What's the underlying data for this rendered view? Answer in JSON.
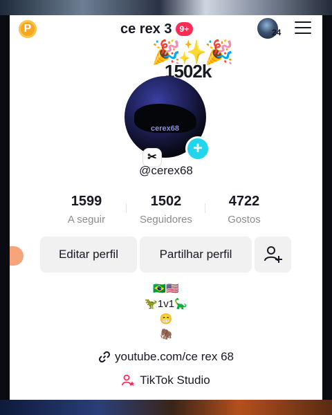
{
  "header": {
    "coin_label": "P",
    "title": "ce rex 3",
    "notification_badge": "9+",
    "avatar_count": "24"
  },
  "profile": {
    "party_emoji": "🎉✨🎉",
    "follower_banner": "1502k",
    "pfp_watermark": "cerex68",
    "username": "@cerex68"
  },
  "stats": [
    {
      "value": "1599",
      "label": "A seguir"
    },
    {
      "value": "1502",
      "label": "Seguidores"
    },
    {
      "value": "4722",
      "label": "Gostos"
    }
  ],
  "buttons": {
    "edit": "Editar perfil",
    "share": "Partilhar perfil"
  },
  "bio": {
    "line1": "🇧🇷🇺🇸",
    "line2": "🦖1v1🦕",
    "line3": "😁",
    "line4": "🦣"
  },
  "links": {
    "youtube": "youtube.com/ce rex 68",
    "studio": "TikTok Studio"
  },
  "colors": {
    "accent": "#fe2c55",
    "teal": "#20d5ec",
    "text": "#161823",
    "muted": "#8a8b91",
    "button_bg": "#f1f1f2"
  },
  "icons": [
    "coin-icon",
    "menu-icon",
    "capcut-icon",
    "add-icon",
    "add-friend-icon",
    "link-icon",
    "studio-icon"
  ]
}
